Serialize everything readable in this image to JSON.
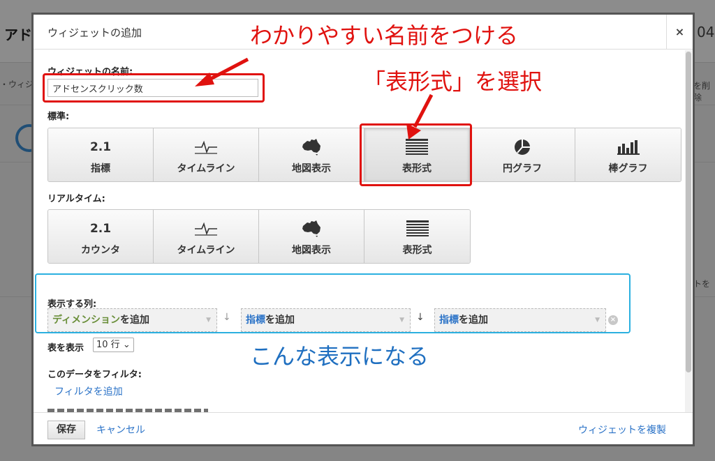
{
  "background": {
    "title_left": "アド",
    "title_right": "04",
    "sub_left": "・ウィジ",
    "sub_right": "を削除",
    "sub_right2": "トを"
  },
  "dialog": {
    "title": "ウィジェットの追加",
    "close_label": "×",
    "name_label": "ウィジェットの名前:",
    "name_value": "アドセンスクリック数",
    "standard_label": "標準:",
    "standard_buttons": [
      {
        "label": "指標",
        "icon_text": "2.1",
        "icon": "number-icon"
      },
      {
        "label": "タイムライン",
        "icon": "timeline-icon"
      },
      {
        "label": "地図表示",
        "icon": "map-icon"
      },
      {
        "label": "表形式",
        "icon": "table-icon",
        "selected": true
      },
      {
        "label": "円グラフ",
        "icon": "pie-chart-icon"
      },
      {
        "label": "棒グラフ",
        "icon": "bar-chart-icon"
      }
    ],
    "realtime_label": "リアルタイム:",
    "realtime_buttons": [
      {
        "label": "カウンタ",
        "icon_text": "2.1",
        "icon": "number-icon"
      },
      {
        "label": "タイムライン",
        "icon": "timeline-icon"
      },
      {
        "label": "地図表示",
        "icon": "map-icon"
      },
      {
        "label": "表形式",
        "icon": "table-icon"
      }
    ],
    "columns_label": "表示する列:",
    "columns": [
      {
        "highlight": "ディメンション",
        "suffix": "を追加"
      },
      {
        "highlight": "指標",
        "suffix": "を追加"
      },
      {
        "highlight": "指標",
        "suffix": "を追加"
      }
    ],
    "rows_label": "表を表示",
    "rows_value": "10 行",
    "filter_label": "このデータをフィルタ:",
    "filter_link": "フィルタを追加"
  },
  "footer": {
    "save": "保存",
    "cancel": "キャンセル",
    "duplicate": "ウィジェットを複製"
  },
  "annotations": {
    "name_hint": "わかりやすい名前をつける",
    "table_hint": "「表形式」を選択",
    "result_hint": "こんな表示になる"
  },
  "colors": {
    "annotation_red": "#e0120f",
    "annotation_blue": "#1f6fc0",
    "highlight_cyan": "#2bb0e0",
    "link_blue": "#2a72c7",
    "dimension_green": "#6a8f3a"
  }
}
